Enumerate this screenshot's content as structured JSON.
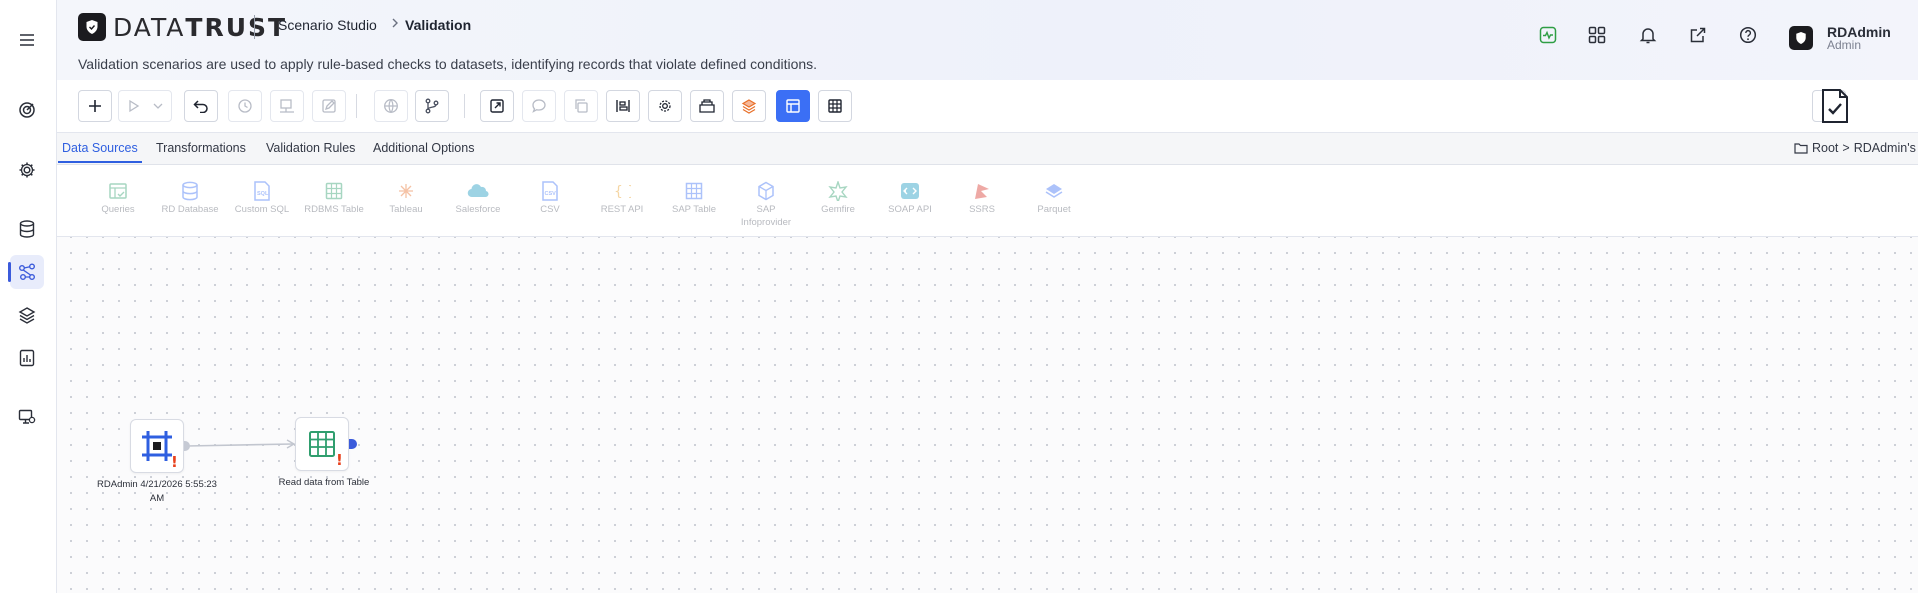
{
  "app": {
    "logo_text_light": "DATA",
    "logo_text_bold": "TRUST",
    "breadcrumb": [
      "Scenario Studio",
      "Validation"
    ],
    "description": "Validation scenarios are used to apply rule-based checks to datasets, identifying records that violate defined conditions."
  },
  "user": {
    "name": "RDAdmin",
    "role": "Admin"
  },
  "sidebar": {
    "items": [
      {
        "icon": "menu-icon"
      },
      {
        "icon": "target-icon"
      },
      {
        "icon": "gear-icon"
      },
      {
        "icon": "database-icon"
      },
      {
        "icon": "flow-icon",
        "active": true
      },
      {
        "icon": "layers-icon"
      },
      {
        "icon": "report-icon"
      },
      {
        "icon": "monitor-icon"
      }
    ]
  },
  "tabs": [
    {
      "label": "Data Sources",
      "active": true
    },
    {
      "label": "Transformations"
    },
    {
      "label": "Validation Rules"
    },
    {
      "label": "Additional Options"
    }
  ],
  "workspace": {
    "root": "Root",
    "sep": ">",
    "name": "RDAdmin's Workspace"
  },
  "palette": [
    {
      "label": "Queries",
      "icon": "queries-icon",
      "color": "#2f9e6e"
    },
    {
      "label": "RD Database",
      "icon": "database-icon",
      "color": "#3b6ff5"
    },
    {
      "label": "Custom SQL",
      "icon": "sql-icon",
      "color": "#3b6ff5"
    },
    {
      "label": "RDBMS Table",
      "icon": "table-icon",
      "color": "#2f9e6e"
    },
    {
      "label": "Tableau",
      "icon": "tableau-icon",
      "color": "#e8702a"
    },
    {
      "label": "Salesforce",
      "icon": "cloud-icon",
      "color": "#1798c1"
    },
    {
      "label": "CSV",
      "icon": "csv-icon",
      "color": "#3b6ff5"
    },
    {
      "label": "REST API",
      "icon": "braces-icon",
      "color": "#e8a02a"
    },
    {
      "label": "SAP Table",
      "icon": "grid-icon",
      "color": "#3b6ff5"
    },
    {
      "label": "SAP\nInfoprovider",
      "icon": "cube-icon",
      "color": "#3b6ff5"
    },
    {
      "label": "Gemfire",
      "icon": "gemfire-icon",
      "color": "#2f9e6e"
    },
    {
      "label": "SOAP API",
      "icon": "soap-icon",
      "color": "#1798c1"
    },
    {
      "label": "SSRS",
      "icon": "ssrs-icon",
      "color": "#d9342b"
    },
    {
      "label": "Parquet",
      "icon": "parquet-icon",
      "color": "#3b6ff5"
    }
  ],
  "nodes": [
    {
      "label": "RDAdmin 4/21/2026 5:55:23 AM",
      "icon": "scenario-node-icon",
      "warning": "!"
    },
    {
      "label": "Read data from Table",
      "icon": "table-node-icon",
      "warning": "!"
    }
  ],
  "colors": {
    "accent": "#3b6ff5",
    "warning": "#e8401c",
    "brand_dark": "#1b1b1f"
  }
}
